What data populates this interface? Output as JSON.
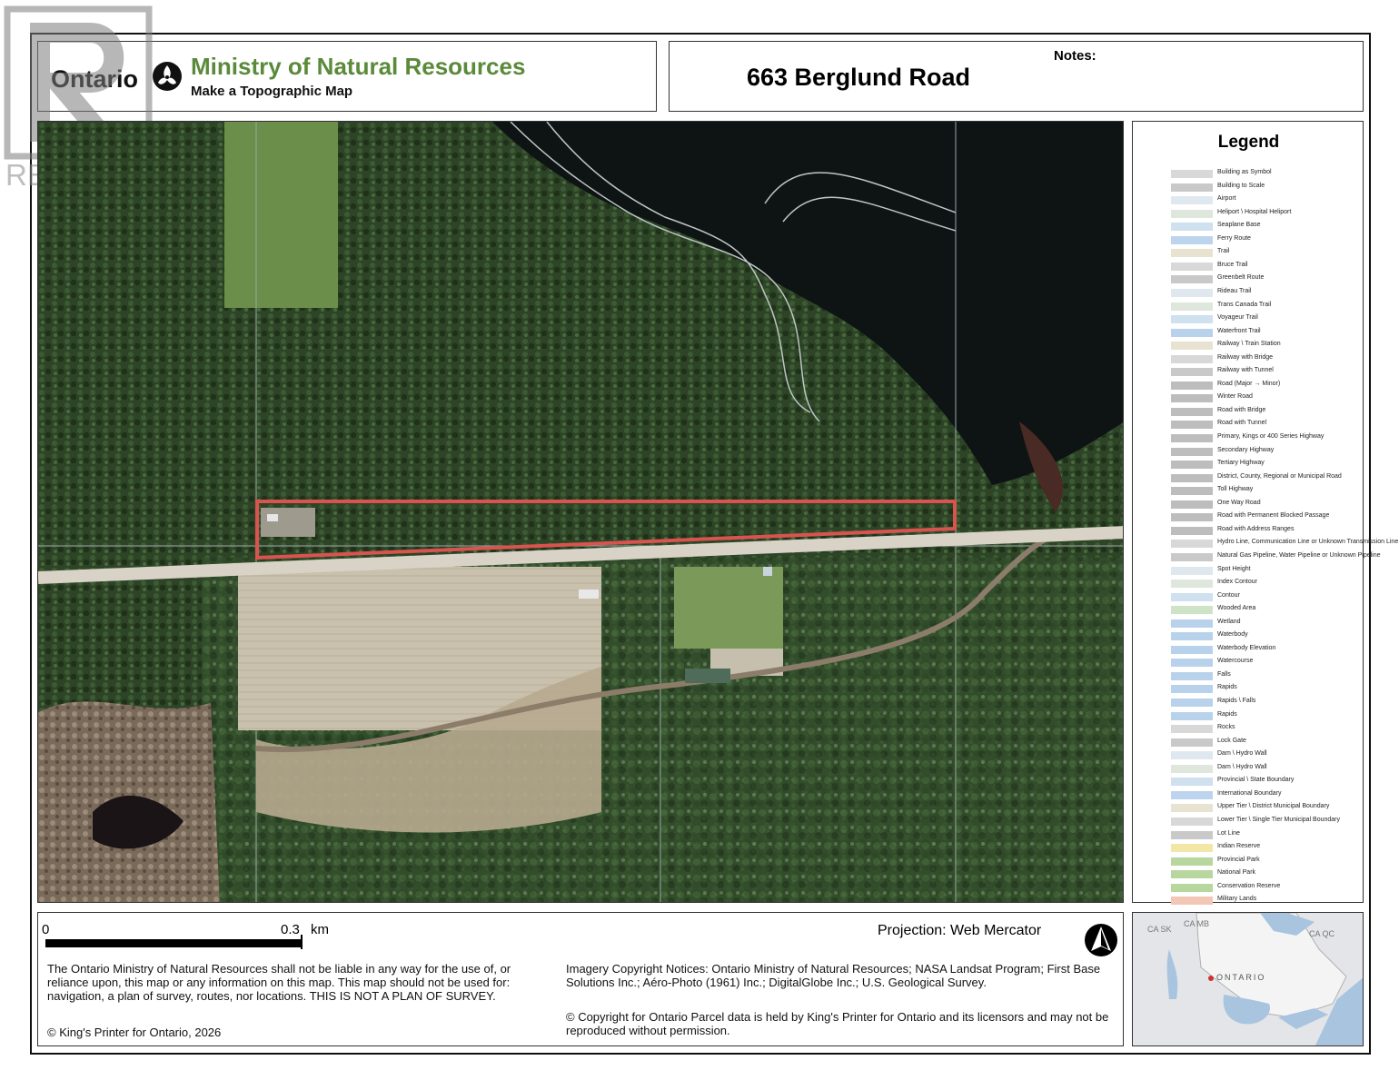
{
  "header": {
    "ontario": "Ontario",
    "ministry": "Ministry of Natural Resources",
    "subtitle": "Make a Topographic Map",
    "map_title": "663 Berglund Road",
    "notes_label": "Notes:"
  },
  "watermark": {
    "text": "REALTOR"
  },
  "legend": {
    "title": "Legend",
    "items": [
      "Building as Symbol",
      "Building to Scale",
      "Airport",
      "Heliport \\ Hospital Heliport",
      "Seaplane Base",
      "Ferry Route",
      "Trail",
      "Bruce Trail",
      "Greenbelt Route",
      "Rideau Trail",
      "Trans Canada Trail",
      "Voyageur Trail",
      "Waterfront Trail",
      "Railway \\ Train Station",
      "Railway with Bridge",
      "Railway with Tunnel",
      "Road (Major → Minor)",
      "Winter Road",
      "Road with Bridge",
      "Road with Tunnel",
      "Primary, Kings or 400 Series Highway",
      "Secondary Highway",
      "Tertiary Highway",
      "District, County, Regional or Municipal Road",
      "Toll Highway",
      "One Way Road",
      "Road with Permanent Blocked Passage",
      "Road with Address Ranges",
      "Hydro Line, Communication Line or Unknown Transmission Line",
      "Natural Gas Pipeline, Water Pipeline or Unknown Pipeline",
      "Spot Height",
      "Index Contour",
      "Contour",
      "Wooded Area",
      "Wetland",
      "Waterbody",
      "Waterbody Elevation",
      "Watercourse",
      "Falls",
      "Rapids",
      "Rapids \\ Falls",
      "Rapids",
      "Rocks",
      "Lock Gate",
      "Dam \\ Hydro Wall",
      "Dam \\ Hydro Wall",
      "Provincial \\ State Boundary",
      "International Boundary",
      "Upper Tier \\ District Municipal Boundary",
      "Lower Tier \\ Single Tier Municipal Boundary",
      "Lot Line",
      "Indian Reserve",
      "Provincial Park",
      "National Park",
      "Conservation Reserve",
      "Military Lands"
    ]
  },
  "scale": {
    "zero": "0",
    "max": "0.3",
    "unit": "km"
  },
  "projection": "Projection: Web Mercator",
  "disclaimer": "The Ontario Ministry of Natural Resources shall not be liable in any way for the use of, or reliance upon, this map or any information on this map.  This map should not be used for: navigation, a plan of survey, routes, nor locations. THIS IS NOT A PLAN OF SURVEY.",
  "copyright": "© King's Printer for Ontario,  2026",
  "imagery": "Imagery Copyright Notices: Ontario Ministry of Natural Resources; NASA Landsat Program; First Base Solutions Inc.; Aéro-Photo (1961) Inc.; DigitalGlobe Inc.; U.S. Geological Survey.",
  "parcel": "© Copyright for Ontario Parcel data is held by King's Printer for Ontario and its licensors and may not be reproduced without permission.",
  "inset": {
    "ca_sk": "CA SK",
    "ca_mb": "CA MB",
    "ca_qc": "CA QC",
    "ontario": "ONTARIO"
  },
  "colors": {
    "ministry_green": "#5a8a3a",
    "parcel_outline": "#d9534f",
    "forest": "#2d4427",
    "water": "#0e1414"
  }
}
